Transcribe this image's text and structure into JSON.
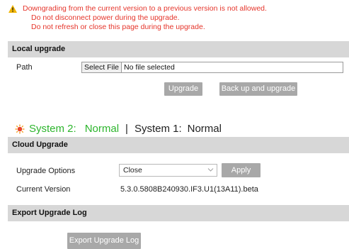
{
  "warning": {
    "lines": [
      "Downgrading from the current version to a previous version is not allowed.",
      "Do not disconnect power during the upgrade.",
      "Do not refresh or close this page during the upgrade."
    ]
  },
  "local_upgrade": {
    "title": "Local upgrade",
    "path_label": "Path",
    "select_file_label": "Select File",
    "file_status": "No file selected",
    "upgrade_button": "Upgrade",
    "backup_upgrade_button": "Back up and upgrade"
  },
  "system_status": {
    "system2_label": "System 2:",
    "system2_value": "Normal",
    "separator": "|",
    "system1_label": "System 1:",
    "system1_value": "Normal"
  },
  "cloud_upgrade": {
    "title": "Cloud Upgrade",
    "options_label": "Upgrade Options",
    "options_selected": "Close",
    "apply_button": "Apply",
    "current_version_label": "Current Version",
    "current_version_value": "5.3.0.5808B240930.IF3.U1(13A11).beta"
  },
  "export_log": {
    "title": "Export Upgrade Log",
    "export_button": "Export Upgrade Log"
  },
  "colors": {
    "warning_text": "#e5352b",
    "status_green": "#2db52d",
    "button_gray": "#a8a8a8",
    "section_header": "#d7d7d7"
  }
}
